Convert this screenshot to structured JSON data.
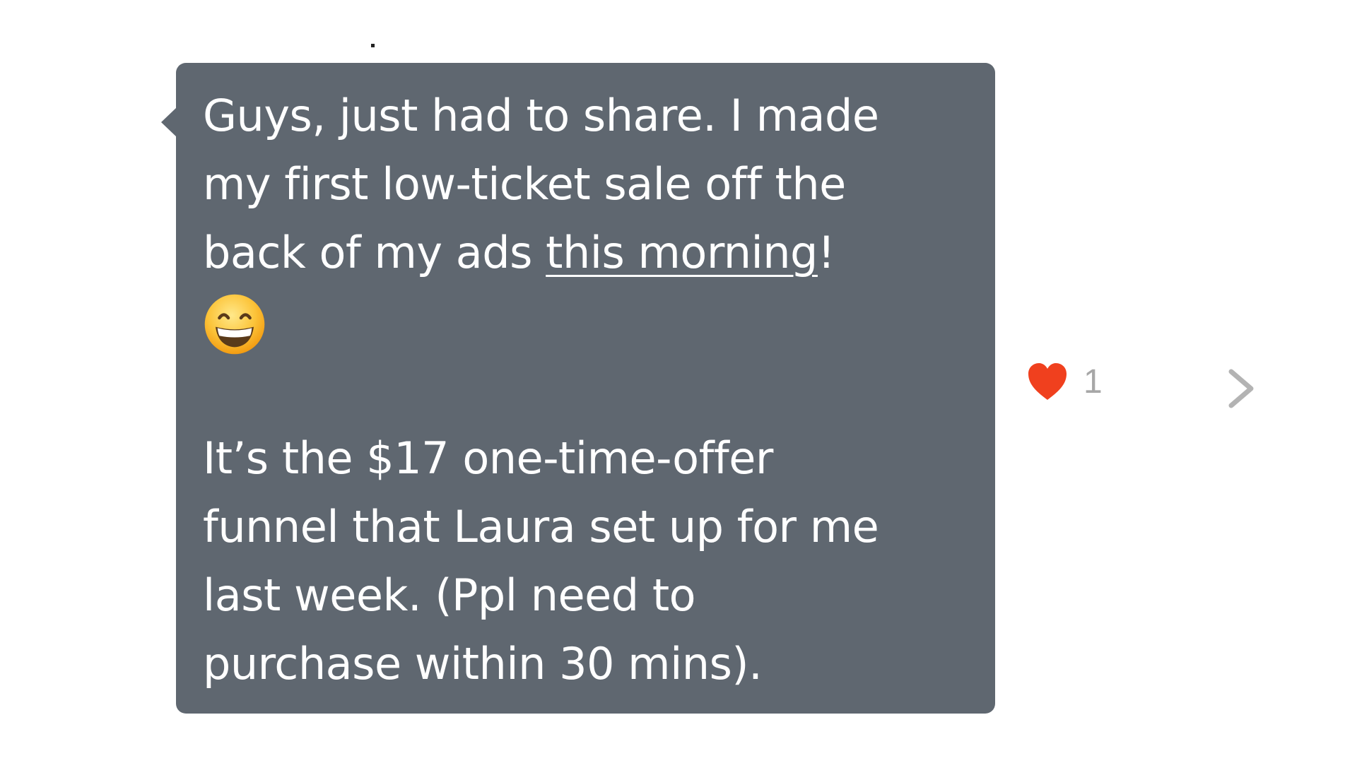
{
  "message": {
    "lines": [
      "Guys, just had to share. I made",
      "my first low-ticket sale off the"
    ],
    "line3_prefix": "back of my ads ",
    "link_text": "this morning",
    "line3_suffix": "!",
    "emoji": "grinning-face-with-smiling-eyes",
    "paragraph2": [
      "It’s the $17 one-time-offer",
      "funnel that Laura set up for me",
      "last week. (Ppl need to",
      "purchase within 30 mins)."
    ]
  },
  "reaction": {
    "icon": "heart-icon",
    "count": "1",
    "color": "#f0401e"
  },
  "navigation": {
    "icon": "chevron-right-icon"
  },
  "colors": {
    "bubble": "#5f6770",
    "text": "#ffffff",
    "muted": "#a7a7a7"
  }
}
